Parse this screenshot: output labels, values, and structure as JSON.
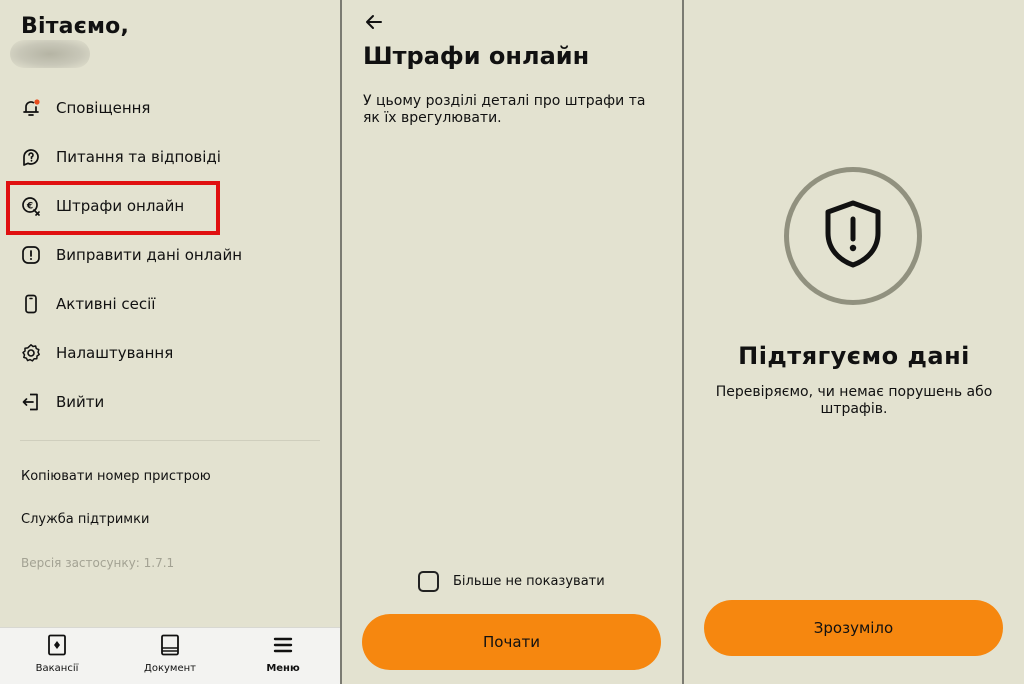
{
  "menu": {
    "greeting": "Вітаємо,",
    "items": [
      {
        "label": "Сповіщення",
        "icon": "bell-icon"
      },
      {
        "label": "Питання та відповіді",
        "icon": "question-chat-icon"
      },
      {
        "label": "Штрафи онлайн",
        "icon": "fines-icon"
      },
      {
        "label": "Виправити дані онлайн",
        "icon": "exclamation-icon"
      },
      {
        "label": "Активні сесії",
        "icon": "phone-icon"
      },
      {
        "label": "Налаштування",
        "icon": "gear-icon"
      },
      {
        "label": "Вийти",
        "icon": "logout-icon"
      }
    ],
    "links": {
      "copy_device": "Копіювати номер пристрою",
      "support": "Служба підтримки"
    },
    "version": "Версія застосунку: 1.7.1",
    "tabs": [
      {
        "label": "Вакансії",
        "icon": "vacancies-icon"
      },
      {
        "label": "Документ",
        "icon": "document-icon"
      },
      {
        "label": "Меню",
        "icon": "menu-icon"
      }
    ]
  },
  "fines_intro": {
    "title": "Штрафи онлайн",
    "description": "У цьому розділі деталі про штрафи та як їх врегулювати.",
    "checkbox_label": "Більше не показувати",
    "checkbox_checked": false,
    "start_button": "Почати"
  },
  "loading": {
    "title": "Підтягуємо дані",
    "description": "Перевіряємо, чи немає порушень або штрафів.",
    "ok_button": "Зрозуміло"
  },
  "colors": {
    "background": "#e3e2d0",
    "accent": "#f6870f",
    "highlight": "#e01010",
    "notification_dot": "#e84c1c"
  }
}
